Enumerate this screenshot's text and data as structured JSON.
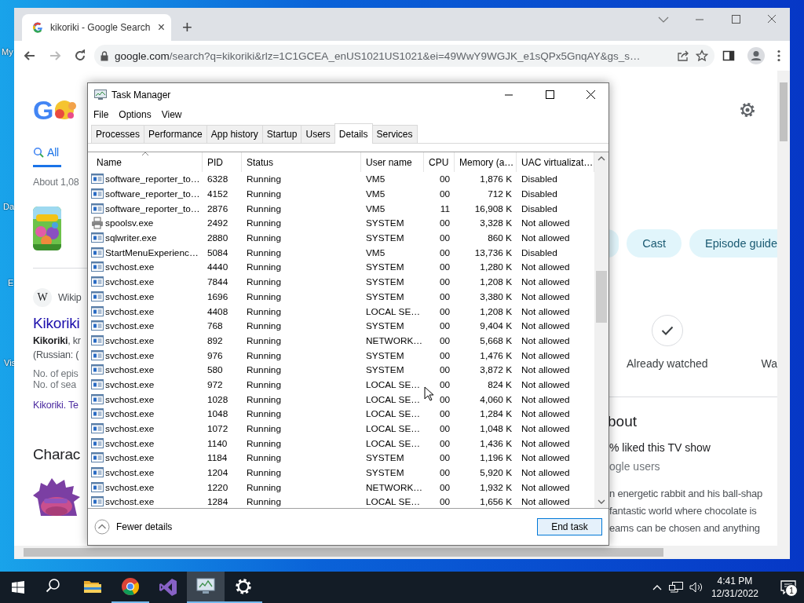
{
  "desktop": {
    "icons": [
      {
        "label": "My"
      },
      {
        "label": "Da"
      },
      {
        "label": "E"
      },
      {
        "label": "Vis"
      }
    ]
  },
  "browser": {
    "tab": {
      "title": "kikoriki - Google Search",
      "close": "×"
    },
    "new_tab": "+",
    "forward_disabled": true,
    "address": {
      "host": "google.com",
      "path": "/search?q=kikoriki&rlz=1C1GCEA_enUS1021US1021&ei=49WwY9WGJK_e1sQPx5GnqAY&gs_s…"
    },
    "page": {
      "logo": "G",
      "search_tab": {
        "label": "All",
        "selected": true
      },
      "result_count": "About 1,08",
      "wiki_icon": "W",
      "wiki_source": "Wikip",
      "wiki_title": "Kikoriki",
      "wiki_lines": [
        "**Kikoriki**, kr",
        "(Russian: ("
      ],
      "facts": [
        "No. of epis",
        "No. of sea"
      ],
      "link": "Kikoriki. Te",
      "section": "Charac",
      "chips": [
        "Cast",
        "Episode guide"
      ],
      "watched": "Already watched",
      "watch_partial": "Wa",
      "about_heading": "bout",
      "rating": "% liked this TV show",
      "rating_source": "ogle users",
      "description": [
        "n energetic rabbit and his ball-shap",
        "fantastic world where chocolate is",
        "eams can be chosen and anything"
      ]
    }
  },
  "task_manager": {
    "title": "Task Manager",
    "menu": [
      "File",
      "Options",
      "View"
    ],
    "tabs": [
      {
        "label": "Processes",
        "selected": false
      },
      {
        "label": "Performance",
        "selected": false
      },
      {
        "label": "App history",
        "selected": false
      },
      {
        "label": "Startup",
        "selected": false
      },
      {
        "label": "Users",
        "selected": false
      },
      {
        "label": "Details",
        "selected": true
      },
      {
        "label": "Services",
        "selected": false
      }
    ],
    "columns": [
      {
        "label": "Name",
        "sorted": true
      },
      {
        "label": "PID",
        "sorted": false
      },
      {
        "label": "Status",
        "sorted": false
      },
      {
        "label": "User name",
        "sorted": false
      },
      {
        "label": "CPU",
        "sorted": false
      },
      {
        "label": "Memory (a…",
        "sorted": false
      },
      {
        "label": "UAC virtualizat…",
        "sorted": false
      }
    ],
    "rows": [
      {
        "kind": "app",
        "name": "software_reporter_to…",
        "pid": "6328",
        "status": "Running",
        "user": "VM5",
        "cpu": "00",
        "memory": "1,876 K",
        "uac": "Disabled"
      },
      {
        "kind": "app",
        "name": "software_reporter_to…",
        "pid": "4152",
        "status": "Running",
        "user": "VM5",
        "cpu": "00",
        "memory": "712 K",
        "uac": "Disabled"
      },
      {
        "kind": "app",
        "name": "software_reporter_to…",
        "pid": "2876",
        "status": "Running",
        "user": "VM5",
        "cpu": "11",
        "memory": "16,908 K",
        "uac": "Disabled"
      },
      {
        "kind": "printer",
        "name": "spoolsv.exe",
        "pid": "2492",
        "status": "Running",
        "user": "SYSTEM",
        "cpu": "00",
        "memory": "3,328 K",
        "uac": "Not allowed"
      },
      {
        "kind": "app",
        "name": "sqlwriter.exe",
        "pid": "2880",
        "status": "Running",
        "user": "SYSTEM",
        "cpu": "00",
        "memory": "860 K",
        "uac": "Not allowed"
      },
      {
        "kind": "app",
        "name": "StartMenuExperienc…",
        "pid": "5084",
        "status": "Running",
        "user": "VM5",
        "cpu": "00",
        "memory": "13,736 K",
        "uac": "Disabled"
      },
      {
        "kind": "app",
        "name": "svchost.exe",
        "pid": "4440",
        "status": "Running",
        "user": "SYSTEM",
        "cpu": "00",
        "memory": "1,280 K",
        "uac": "Not allowed"
      },
      {
        "kind": "app",
        "name": "svchost.exe",
        "pid": "7844",
        "status": "Running",
        "user": "SYSTEM",
        "cpu": "00",
        "memory": "1,208 K",
        "uac": "Not allowed"
      },
      {
        "kind": "app",
        "name": "svchost.exe",
        "pid": "1696",
        "status": "Running",
        "user": "SYSTEM",
        "cpu": "00",
        "memory": "3,380 K",
        "uac": "Not allowed"
      },
      {
        "kind": "app",
        "name": "svchost.exe",
        "pid": "4408",
        "status": "Running",
        "user": "LOCAL SE…",
        "cpu": "00",
        "memory": "1,208 K",
        "uac": "Not allowed"
      },
      {
        "kind": "app",
        "name": "svchost.exe",
        "pid": "768",
        "status": "Running",
        "user": "SYSTEM",
        "cpu": "00",
        "memory": "9,404 K",
        "uac": "Not allowed"
      },
      {
        "kind": "app",
        "name": "svchost.exe",
        "pid": "892",
        "status": "Running",
        "user": "NETWORK…",
        "cpu": "00",
        "memory": "5,668 K",
        "uac": "Not allowed"
      },
      {
        "kind": "app",
        "name": "svchost.exe",
        "pid": "976",
        "status": "Running",
        "user": "SYSTEM",
        "cpu": "00",
        "memory": "1,476 K",
        "uac": "Not allowed"
      },
      {
        "kind": "app",
        "name": "svchost.exe",
        "pid": "580",
        "status": "Running",
        "user": "SYSTEM",
        "cpu": "00",
        "memory": "3,872 K",
        "uac": "Not allowed"
      },
      {
        "kind": "app",
        "name": "svchost.exe",
        "pid": "972",
        "status": "Running",
        "user": "LOCAL SE…",
        "cpu": "00",
        "memory": "824 K",
        "uac": "Not allowed"
      },
      {
        "kind": "app",
        "name": "svchost.exe",
        "pid": "1028",
        "status": "Running",
        "user": "LOCAL SE…",
        "cpu": "00",
        "memory": "4,060 K",
        "uac": "Not allowed"
      },
      {
        "kind": "app",
        "name": "svchost.exe",
        "pid": "1048",
        "status": "Running",
        "user": "LOCAL SE…",
        "cpu": "00",
        "memory": "1,284 K",
        "uac": "Not allowed"
      },
      {
        "kind": "app",
        "name": "svchost.exe",
        "pid": "1072",
        "status": "Running",
        "user": "LOCAL SE…",
        "cpu": "00",
        "memory": "1,048 K",
        "uac": "Not allowed"
      },
      {
        "kind": "app",
        "name": "svchost.exe",
        "pid": "1140",
        "status": "Running",
        "user": "LOCAL SE…",
        "cpu": "00",
        "memory": "1,436 K",
        "uac": "Not allowed"
      },
      {
        "kind": "app",
        "name": "svchost.exe",
        "pid": "1184",
        "status": "Running",
        "user": "SYSTEM",
        "cpu": "00",
        "memory": "1,196 K",
        "uac": "Not allowed"
      },
      {
        "kind": "app",
        "name": "svchost.exe",
        "pid": "1204",
        "status": "Running",
        "user": "SYSTEM",
        "cpu": "00",
        "memory": "5,920 K",
        "uac": "Not allowed"
      },
      {
        "kind": "app",
        "name": "svchost.exe",
        "pid": "1220",
        "status": "Running",
        "user": "NETWORK…",
        "cpu": "00",
        "memory": "1,932 K",
        "uac": "Not allowed"
      },
      {
        "kind": "app",
        "name": "svchost.exe",
        "pid": "1284",
        "status": "Running",
        "user": "LOCAL SE…",
        "cpu": "00",
        "memory": "1,656 K",
        "uac": "Not allowed"
      }
    ],
    "fewer_details": "Fewer details",
    "end_task": "End task"
  },
  "taskbar": {
    "apps": [
      {
        "kind": "search",
        "running": false,
        "selected": false
      },
      {
        "kind": "folder",
        "running": false,
        "selected": false
      },
      {
        "kind": "chrome",
        "running": true,
        "selected": false
      },
      {
        "kind": "studio",
        "running": false,
        "selected": false
      },
      {
        "kind": "monitor",
        "running": true,
        "selected": true
      },
      {
        "kind": "settings",
        "running": true,
        "selected": false
      }
    ],
    "time": "4:41 PM",
    "date": "12/31/2022",
    "notifications": "1"
  }
}
